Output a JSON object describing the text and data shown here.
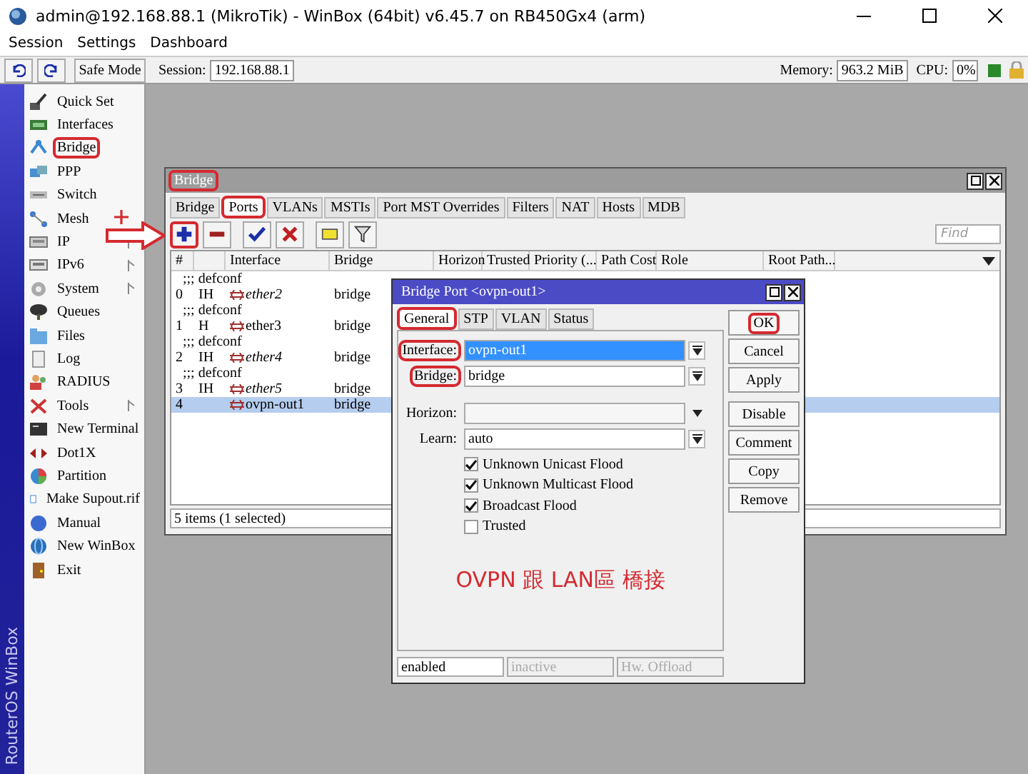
{
  "window": {
    "title": "admin@192.168.88.1 (MikroTik) - WinBox (64bit) v6.45.7 on RB450Gx4 (arm)"
  },
  "menu": [
    "Session",
    "Settings",
    "Dashboard"
  ],
  "toolbar": {
    "safe_mode": "Safe Mode",
    "session_label": "Session:",
    "session": "192.168.88.1",
    "memory_label": "Memory:",
    "memory": "963.2 MiB",
    "cpu_label": "CPU:",
    "cpu": "0%"
  },
  "side_banner": "RouterOS WinBox",
  "sidebar": [
    {
      "label": "Quick Set",
      "submenu": false,
      "annotated": false
    },
    {
      "label": "Interfaces",
      "submenu": false,
      "annotated": false
    },
    {
      "label": "Bridge",
      "submenu": false,
      "annotated": true
    },
    {
      "label": "PPP",
      "submenu": false,
      "annotated": false
    },
    {
      "label": "Switch",
      "submenu": false,
      "annotated": false
    },
    {
      "label": "Mesh",
      "submenu": false,
      "annotated": false
    },
    {
      "label": "IP",
      "submenu": true,
      "annotated": false
    },
    {
      "label": "IPv6",
      "submenu": true,
      "annotated": false
    },
    {
      "label": "System",
      "submenu": true,
      "annotated": false
    },
    {
      "label": "Queues",
      "submenu": false,
      "annotated": false
    },
    {
      "label": "Files",
      "submenu": false,
      "annotated": false
    },
    {
      "label": "Log",
      "submenu": false,
      "annotated": false
    },
    {
      "label": "RADIUS",
      "submenu": false,
      "annotated": false
    },
    {
      "label": "Tools",
      "submenu": true,
      "annotated": false
    },
    {
      "label": "New Terminal",
      "submenu": false,
      "annotated": false
    },
    {
      "label": "Dot1X",
      "submenu": false,
      "annotated": false
    },
    {
      "label": "Partition",
      "submenu": false,
      "annotated": false
    },
    {
      "label": "Make Supout.rif",
      "submenu": false,
      "annotated": false
    },
    {
      "label": "Manual",
      "submenu": false,
      "annotated": false
    },
    {
      "label": "New WinBox",
      "submenu": false,
      "annotated": false
    },
    {
      "label": "Exit",
      "submenu": false,
      "annotated": false
    }
  ],
  "annotations": {
    "plus_mark": true,
    "arrow": true
  },
  "bridge_window": {
    "title": "Bridge",
    "title_annotated": true,
    "tabs": [
      {
        "label": "Bridge",
        "selected": false,
        "annotated": false
      },
      {
        "label": "Ports",
        "selected": true,
        "annotated": true
      },
      {
        "label": "VLANs",
        "selected": false,
        "annotated": false
      },
      {
        "label": "MSTIs",
        "selected": false,
        "annotated": false
      },
      {
        "label": "Port MST Overrides",
        "selected": false,
        "annotated": false
      },
      {
        "label": "Filters",
        "selected": false,
        "annotated": false
      },
      {
        "label": "NAT",
        "selected": false,
        "annotated": false
      },
      {
        "label": "Hosts",
        "selected": false,
        "annotated": false
      },
      {
        "label": "MDB",
        "selected": false,
        "annotated": false
      }
    ],
    "tools": [
      {
        "kind": "add",
        "annotated": true
      },
      {
        "kind": "remove",
        "annotated": false
      },
      {
        "kind": "enable",
        "annotated": false
      },
      {
        "kind": "disable",
        "annotated": false
      },
      {
        "kind": "comment",
        "annotated": false
      },
      {
        "kind": "filter",
        "annotated": false
      }
    ],
    "find": {
      "placeholder": "Find"
    },
    "columns": [
      "#",
      "Interface",
      "Bridge",
      "Horizon",
      "Trusted",
      "Priority (...",
      "Path Cost",
      "Role",
      "Root Path..."
    ],
    "rows": [
      {
        "kind": "comment",
        "text": ";;; defconf"
      },
      {
        "kind": "port",
        "number": "0",
        "flags": "IH",
        "interface": "ether2",
        "bridge": "bridge",
        "inactive": true,
        "selected": false
      },
      {
        "kind": "comment",
        "text": ";;; defconf"
      },
      {
        "kind": "port",
        "number": "1",
        "flags": "H",
        "interface": "ether3",
        "bridge": "bridge",
        "inactive": false,
        "selected": false
      },
      {
        "kind": "comment",
        "text": ";;; defconf"
      },
      {
        "kind": "port",
        "number": "2",
        "flags": "IH",
        "interface": "ether4",
        "bridge": "bridge",
        "inactive": true,
        "selected": false
      },
      {
        "kind": "comment",
        "text": ";;; defconf"
      },
      {
        "kind": "port",
        "number": "3",
        "flags": "IH",
        "interface": "ether5",
        "bridge": "bridge",
        "inactive": true,
        "selected": false
      },
      {
        "kind": "port",
        "number": "4",
        "interface": "ovpn-out1",
        "bridge": "bridge",
        "inactive": false,
        "selected": true
      }
    ],
    "status": "5 items (1 selected)"
  },
  "dialog": {
    "title": "Bridge Port <ovpn-out1>",
    "tabs": [
      {
        "label": "General",
        "selected": true,
        "annotated": true
      },
      {
        "label": "STP",
        "selected": false,
        "annotated": false
      },
      {
        "label": "VLAN",
        "selected": false,
        "annotated": false
      },
      {
        "label": "Status",
        "selected": false,
        "annotated": false
      }
    ],
    "fields": [
      {
        "kind": "dropdown",
        "label": "Interface:",
        "value": "ovpn-out1",
        "highlighted": true,
        "annotated": true
      },
      {
        "kind": "dropdown",
        "label": "Bridge:",
        "value": "bridge",
        "highlighted": false,
        "annotated": true
      },
      {
        "kind": "combo",
        "label": "Horizon:",
        "highlighted": false,
        "annotated": false
      },
      {
        "kind": "dropdown",
        "label": "Learn:",
        "value": "auto",
        "highlighted": false,
        "annotated": false
      }
    ],
    "checkboxes": [
      {
        "label": "Unknown Unicast Flood",
        "checked": true
      },
      {
        "label": "Unknown Multicast Flood",
        "checked": true
      },
      {
        "label": "Broadcast Flood",
        "checked": true
      },
      {
        "label": "Trusted",
        "checked": false
      }
    ],
    "caption": "OVPN 跟 LAN區 橋接",
    "buttons": [
      {
        "label": "OK",
        "annotated": true
      },
      {
        "label": "Cancel",
        "annotated": false
      },
      {
        "label": "Apply",
        "annotated": false
      },
      {
        "label": "Disable",
        "annotated": false
      },
      {
        "label": "Comment",
        "annotated": false
      },
      {
        "label": "Copy",
        "annotated": false
      },
      {
        "label": "Remove",
        "annotated": false
      }
    ],
    "status": [
      {
        "text": "enabled",
        "dim": false
      },
      {
        "text": "inactive",
        "dim": true
      },
      {
        "text": "Hw. Offload",
        "dim": true
      }
    ]
  }
}
